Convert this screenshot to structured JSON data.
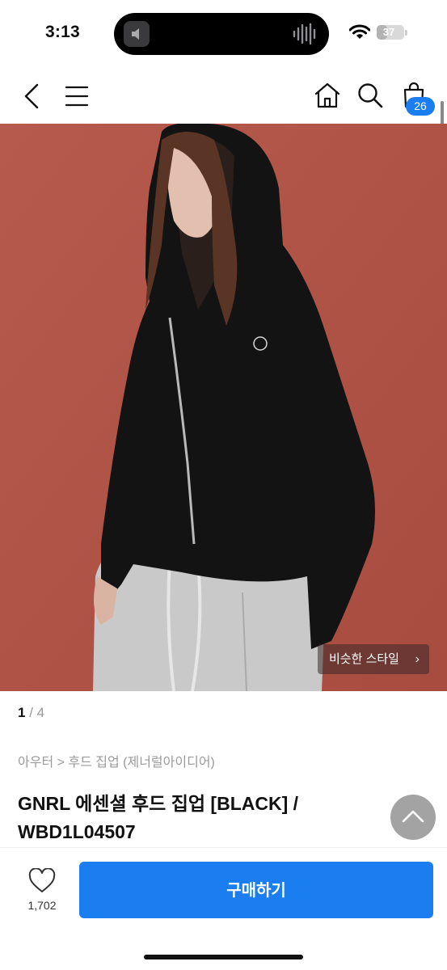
{
  "status_bar": {
    "time": "3:13",
    "battery_level": "37",
    "battery_fraction": 0.37,
    "icons": [
      "volume-icon",
      "sound-wave-icon",
      "wifi-icon",
      "battery-icon"
    ]
  },
  "nav": {
    "icons": [
      "back-icon",
      "menu-icon",
      "home-icon",
      "search-icon",
      "cart-icon"
    ],
    "cart_count": "26"
  },
  "hero": {
    "similar_style_label": "비슷한 스타일",
    "similar_style_chevron": "›",
    "background_color": "#b5584b"
  },
  "gallery": {
    "current": "1",
    "separator": " / ",
    "total": "4"
  },
  "product": {
    "breadcrumb": "아우터 > 후드 집업 (제너럴아이디어)",
    "title": "GNRL 에센셜 후드 집업 [BLACK] / WBD1L04507"
  },
  "bottom_bar": {
    "like_count": "1,702",
    "buy_label": "구매하기",
    "accent_color": "#1a7df0"
  }
}
